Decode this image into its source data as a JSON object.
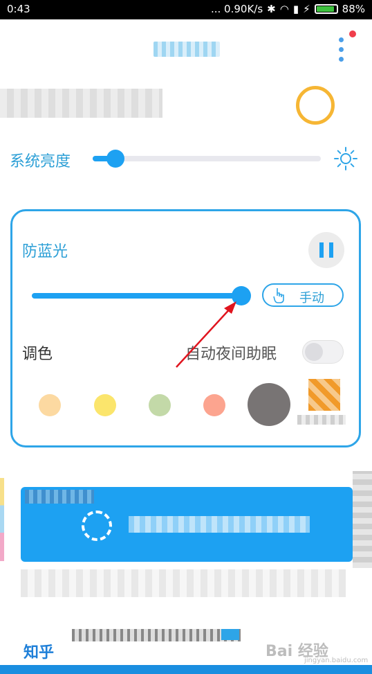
{
  "status_bar": {
    "time": "0:43",
    "speed": "... 0.90K/s",
    "battery": "88%"
  },
  "brightness": {
    "label": "系统亮度",
    "value_fraction": 0.1
  },
  "blue_light": {
    "title": "防蓝光",
    "intensity_fraction": 0.99,
    "mode_button": "手动",
    "tone_label": "调色",
    "auto_night_label": "自动夜间助眠",
    "auto_night_on": false,
    "swatches": [
      "#fcd9a1",
      "#fbe56c",
      "#c3d9a8",
      "#fca48f",
      "#787474"
    ]
  },
  "footer": {
    "zhihu": "知乎",
    "watermark": "Bai 经验",
    "watermark_sub": "jingyan.baidu.com"
  },
  "colors": {
    "accent": "#1da1f2",
    "arrow": "#e0141e"
  }
}
